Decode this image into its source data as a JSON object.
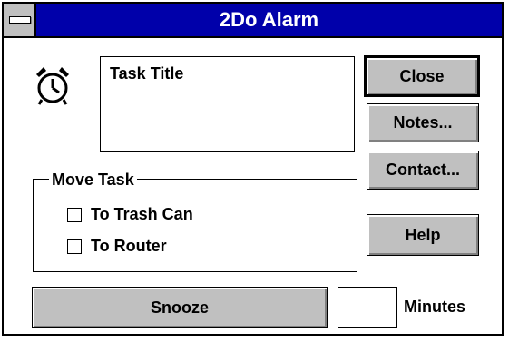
{
  "window": {
    "title": "2Do Alarm"
  },
  "task": {
    "title": "Task Title"
  },
  "buttons": {
    "close": "Close",
    "notes": "Notes...",
    "contact": "Contact...",
    "help": "Help",
    "snooze": "Snooze"
  },
  "move_task": {
    "group_label": "Move Task",
    "options": [
      {
        "label": "To Trash Can",
        "checked": false
      },
      {
        "label": "To Router",
        "checked": false
      }
    ]
  },
  "minutes": {
    "label": "Minutes",
    "value": ""
  },
  "colors": {
    "titlebar": "#0000aa",
    "button_face": "#c0c0c0"
  }
}
